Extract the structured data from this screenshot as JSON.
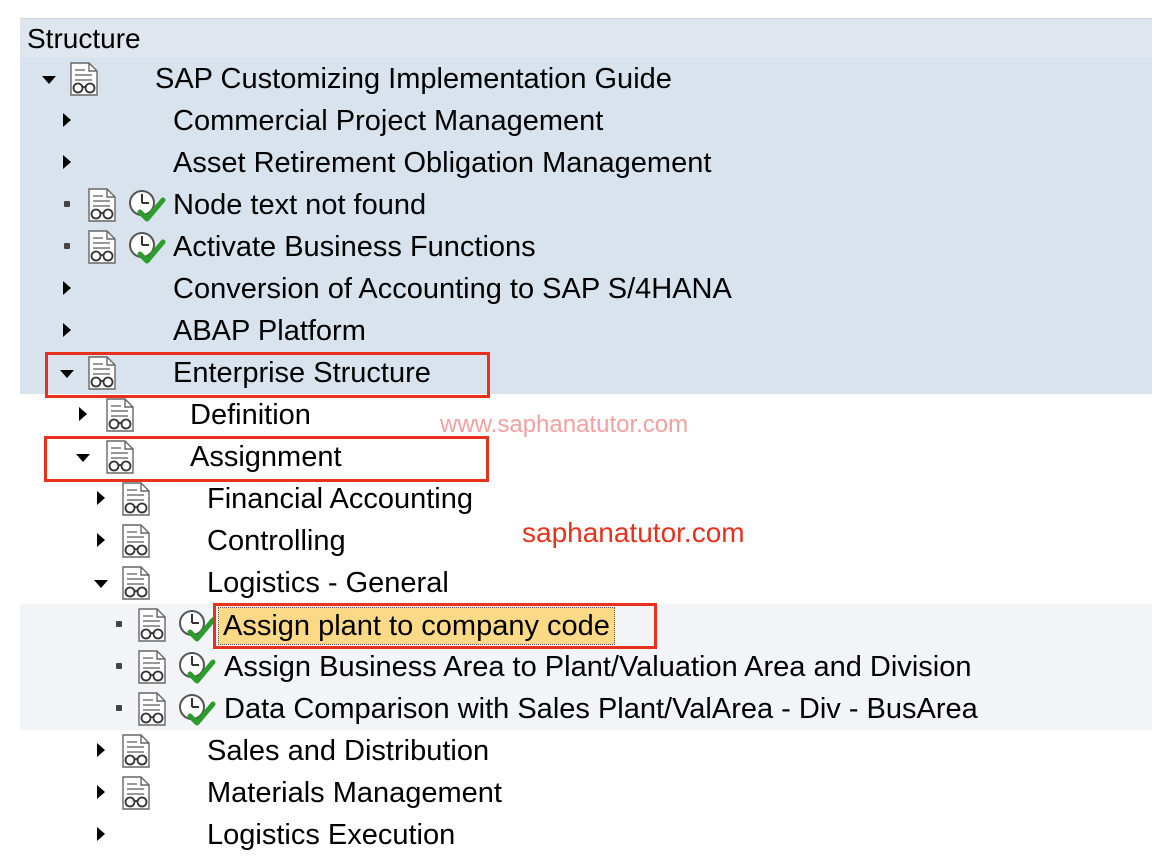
{
  "tree": {
    "header": "Structure",
    "rows": [
      {
        "label": "SAP Customizing Implementation Guide",
        "control": "expanded",
        "icons": [
          "documentation-icon"
        ]
      },
      {
        "label": "Commercial Project Management",
        "control": "collapsed",
        "icons": []
      },
      {
        "label": "Asset Retirement Obligation Management",
        "control": "collapsed",
        "icons": []
      },
      {
        "label": "Node text not found",
        "control": "leaf",
        "icons": [
          "documentation-icon",
          "execute-activity-icon"
        ]
      },
      {
        "label": "Activate Business Functions",
        "control": "leaf",
        "icons": [
          "documentation-icon",
          "execute-activity-icon"
        ]
      },
      {
        "label": "Conversion of Accounting to SAP S/4HANA",
        "control": "collapsed",
        "icons": []
      },
      {
        "label": "ABAP Platform",
        "control": "collapsed",
        "icons": []
      },
      {
        "label": "Enterprise Structure",
        "control": "expanded",
        "icons": [
          "documentation-icon"
        ],
        "highlighted": true
      },
      {
        "label": "Definition",
        "control": "collapsed",
        "icons": [
          "documentation-icon"
        ]
      },
      {
        "label": "Assignment",
        "control": "expanded",
        "icons": [
          "documentation-icon"
        ],
        "highlighted": true
      },
      {
        "label": "Financial Accounting",
        "control": "collapsed",
        "icons": [
          "documentation-icon"
        ]
      },
      {
        "label": "Controlling",
        "control": "collapsed",
        "icons": [
          "documentation-icon"
        ]
      },
      {
        "label": "Logistics - General",
        "control": "expanded",
        "icons": [
          "documentation-icon"
        ]
      },
      {
        "label": "Assign plant to company code",
        "control": "leaf",
        "icons": [
          "documentation-icon",
          "execute-activity-icon"
        ],
        "selected": true,
        "highlighted": true
      },
      {
        "label": "Assign Business Area to Plant/Valuation Area and Division",
        "control": "leaf",
        "icons": [
          "documentation-icon",
          "execute-activity-icon"
        ]
      },
      {
        "label": "Data Comparison with Sales Plant/ValArea - Div - BusArea",
        "control": "leaf",
        "icons": [
          "documentation-icon",
          "execute-activity-icon"
        ]
      },
      {
        "label": "Sales and Distribution",
        "control": "collapsed",
        "icons": [
          "documentation-icon"
        ]
      },
      {
        "label": "Materials Management",
        "control": "collapsed",
        "icons": [
          "documentation-icon"
        ]
      },
      {
        "label": "Logistics Execution",
        "control": "collapsed",
        "icons": []
      }
    ]
  },
  "watermarks": {
    "primary": "www.saphanatutor.com",
    "secondary": "saphanatutor.com"
  },
  "colors": {
    "row_background": "#d9e3ee",
    "selection": "#fbd987",
    "annotation_red": "#e8311c",
    "check_green": "#2a9d2a"
  }
}
